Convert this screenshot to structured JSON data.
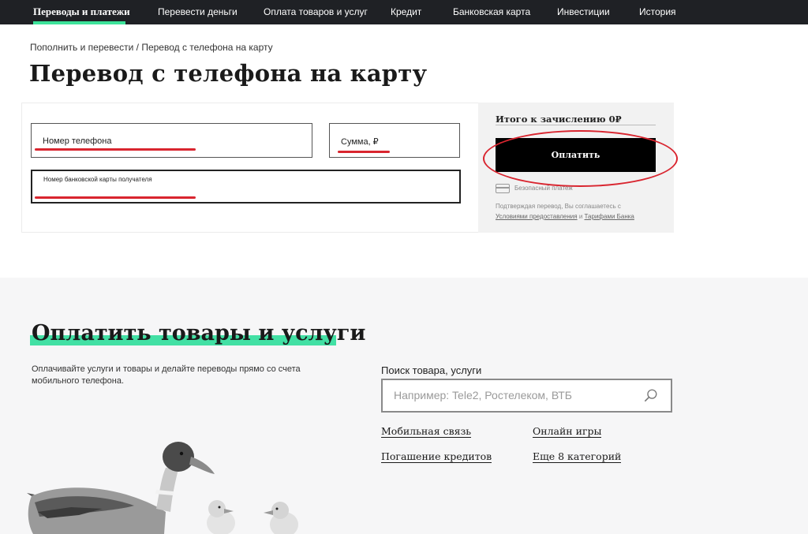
{
  "nav": {
    "items": [
      {
        "label": "Переводы и платежи",
        "active": true
      },
      {
        "label": "Перевести деньги"
      },
      {
        "label": "Оплата товаров и услуг"
      },
      {
        "label": "Кредит"
      },
      {
        "label": "Банковская карта"
      },
      {
        "label": "Инвестиции"
      },
      {
        "label": "История"
      }
    ]
  },
  "breadcrumb": {
    "parent": "Пополнить и перевести",
    "separator": " / ",
    "current": "Перевод с телефона на карту"
  },
  "page_title": "Перевод с телефона на карту",
  "form": {
    "phone_label": "Номер телефона",
    "amount_label": "Сумма, ₽",
    "card_label": "Номер банковской карты получателя"
  },
  "summary": {
    "total_label": "Итого к зачислению 0₽",
    "pay_button": "Оплатить",
    "secure_text": "Безопасный платеж",
    "terms_prefix": "Подтверждая перевод, Вы соглашаетесь с",
    "terms_link1": "Условиями предоставления",
    "terms_and": " и ",
    "terms_link2": "Тарифами Банка"
  },
  "services": {
    "title": "Оплатить товары и услуги",
    "description": "Оплачивайте услуги и товары и делайте переводы прямо со счета мобильного телефона.",
    "search_label": "Поиск товара, услуги",
    "search_placeholder": "Например: Tele2, Ростелеком, ВТБ",
    "categories": [
      "Мобильная связь",
      "Онлайн игры",
      "Погашение кредитов",
      "Еще 8 категорий"
    ]
  },
  "colors": {
    "nav_bg": "#1f2125",
    "accent_green": "#3de39a",
    "annotation_red": "#d9252f",
    "button_black": "#000000"
  }
}
